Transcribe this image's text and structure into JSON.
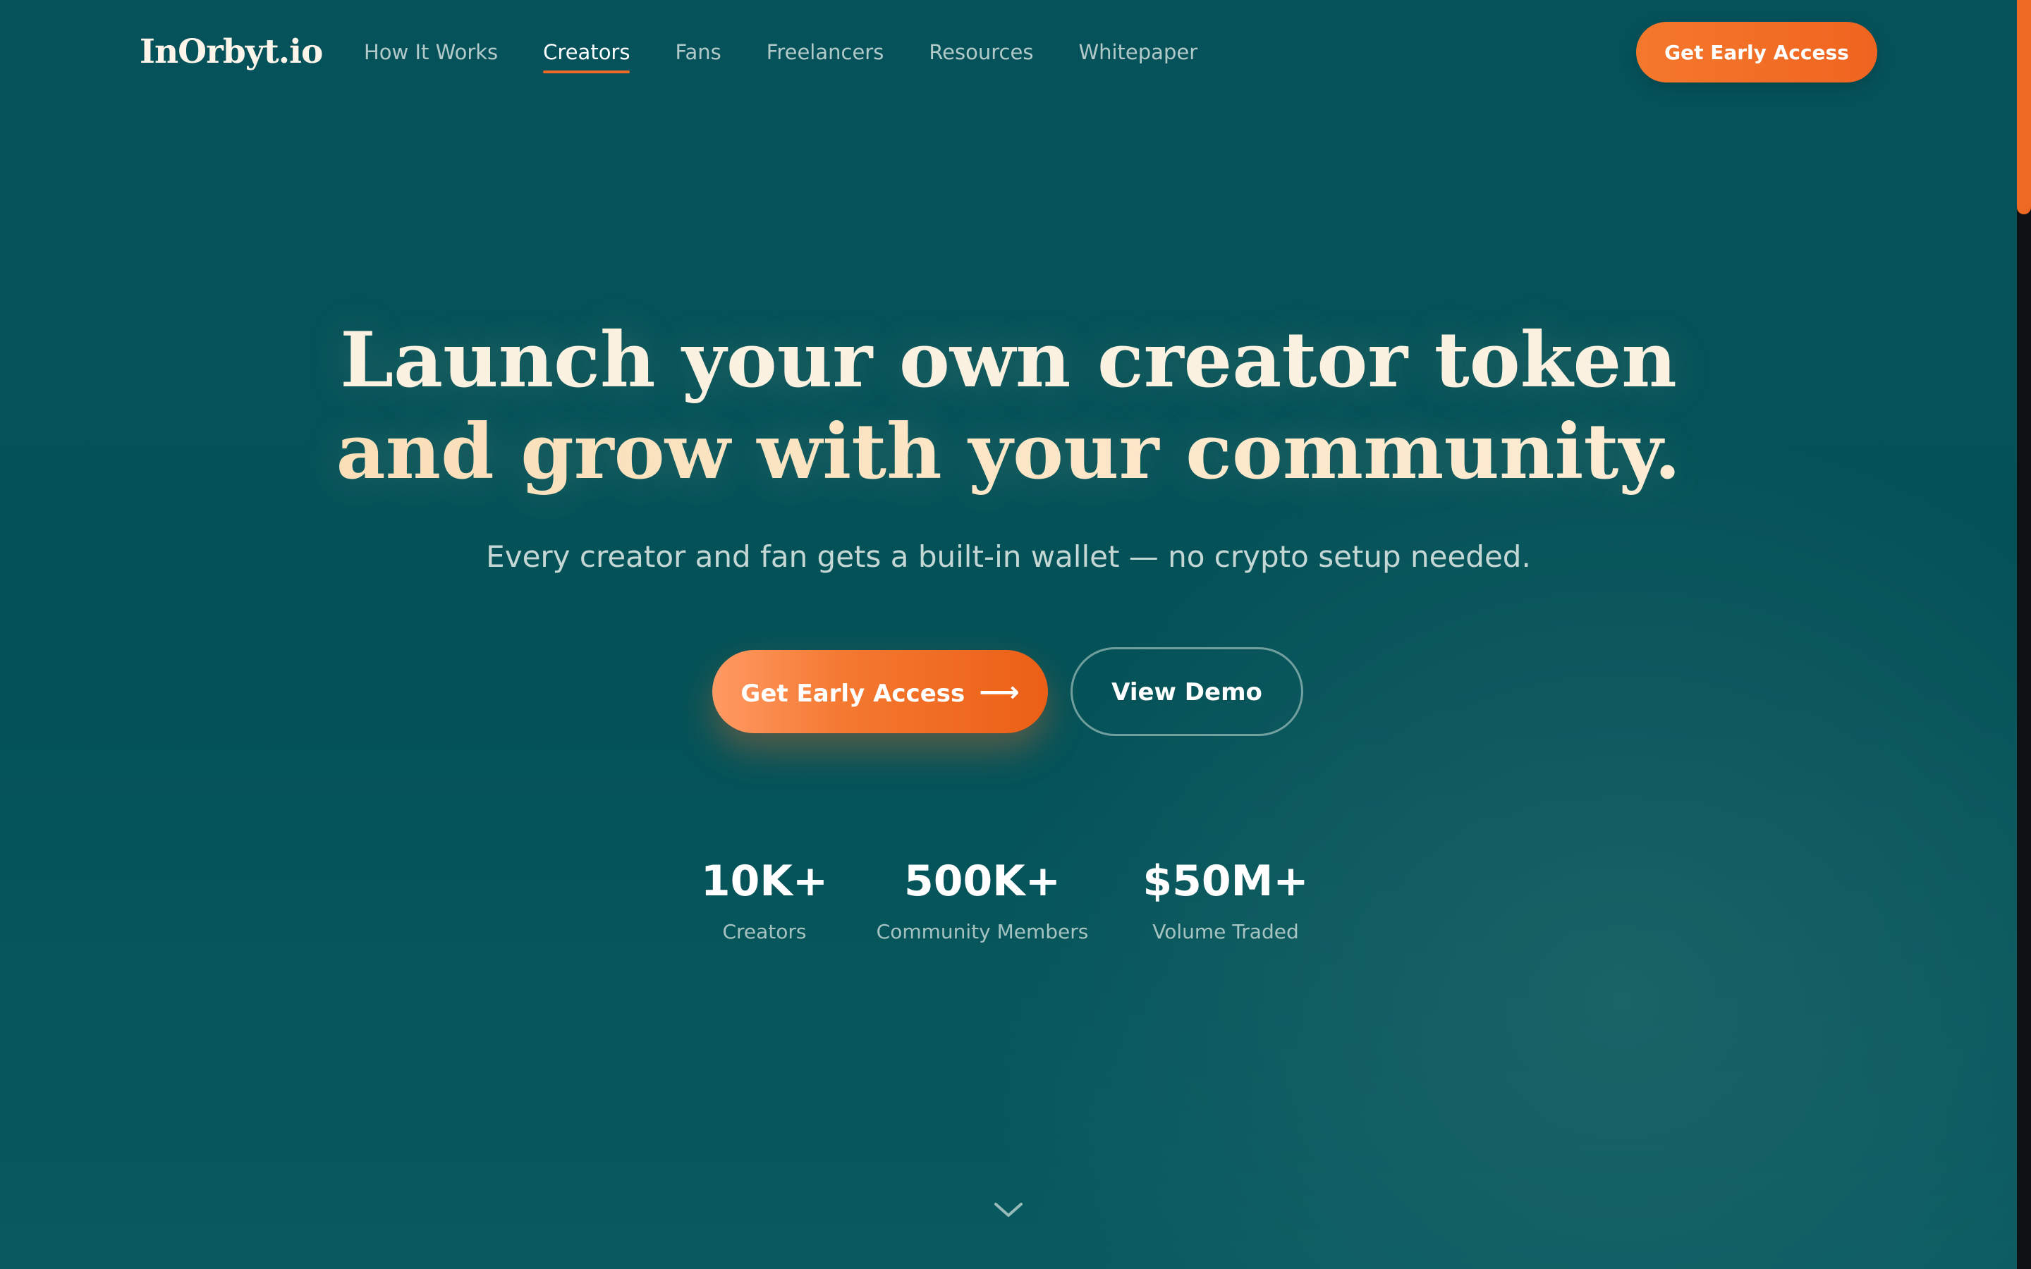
{
  "brand": {
    "logo_text": "InOrbyt.io",
    "accent_color": "#EE6A24",
    "background_color": "#045258"
  },
  "nav": {
    "items": [
      {
        "label": "How It Works",
        "active": false
      },
      {
        "label": "Creators",
        "active": true
      },
      {
        "label": "Fans",
        "active": false
      },
      {
        "label": "Freelancers",
        "active": false
      },
      {
        "label": "Resources",
        "active": false
      },
      {
        "label": "Whitepaper",
        "active": false
      }
    ],
    "cta_label": "Get Early Access"
  },
  "hero": {
    "title_line_1": "Launch your own creator token",
    "title_line_2": "and grow with your community.",
    "subtitle": "Every creator and fan gets a built-in wallet — no crypto setup needed.",
    "primary_cta_label": "Get Early Access",
    "primary_cta_icon": "arrow-right-icon",
    "secondary_cta_label": "View Demo"
  },
  "stats": [
    {
      "value": "10K+",
      "label": "Creators"
    },
    {
      "value": "500K+",
      "label": "Community Members"
    },
    {
      "value": "$50M+",
      "label": "Volume Traded"
    }
  ],
  "scroll_indicator_icon": "chevron-down-icon"
}
